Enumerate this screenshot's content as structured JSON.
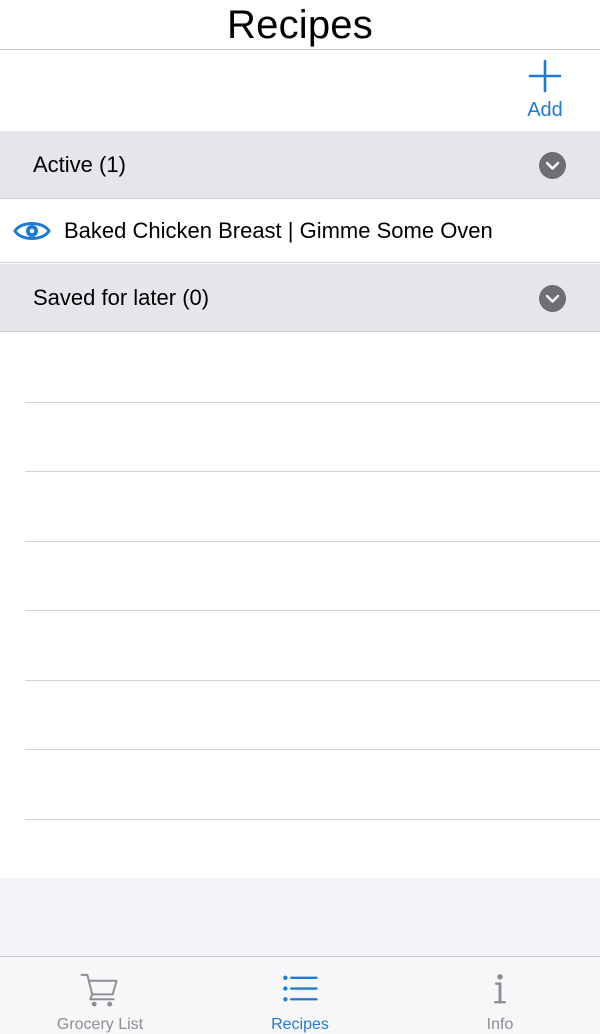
{
  "header": {
    "title": "Recipes"
  },
  "toolbar": {
    "add_label": "Add"
  },
  "sections": [
    {
      "label": "Active (1)"
    },
    {
      "label": "Saved for later (0)"
    }
  ],
  "recipes": [
    {
      "title": "Baked Chicken Breast | Gimme Some Oven"
    }
  ],
  "tabs": [
    {
      "label": "Grocery List",
      "icon": "cart-icon",
      "active": false
    },
    {
      "label": "Recipes",
      "icon": "list-icon",
      "active": true
    },
    {
      "label": "Info",
      "icon": "info-icon",
      "active": false
    }
  ],
  "colors": {
    "accent": "#1d7bd6",
    "section_bg": "#e5e5ea",
    "chevron": "#6e6e73",
    "inactive_tab": "#8e8e93"
  }
}
